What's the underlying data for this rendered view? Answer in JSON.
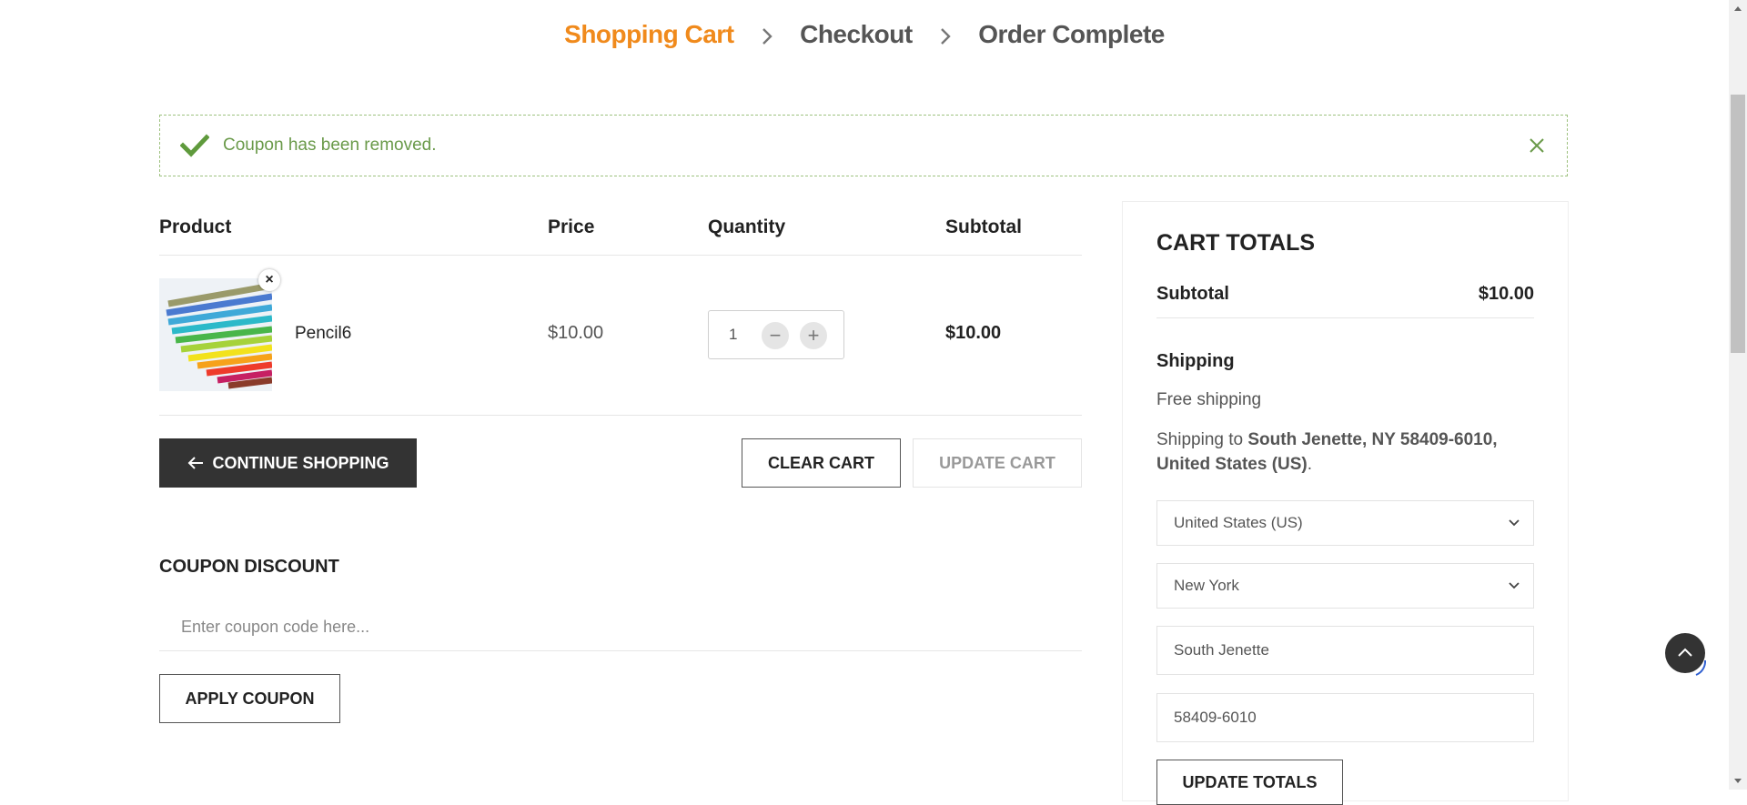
{
  "steps": {
    "cart": "Shopping Cart",
    "checkout": "Checkout",
    "complete": "Order Complete"
  },
  "notice": {
    "message": "Coupon has been removed.",
    "color": "#6a9a4a"
  },
  "table": {
    "headers": {
      "product": "Product",
      "price": "Price",
      "quantity": "Quantity",
      "subtotal": "Subtotal"
    },
    "item": {
      "name": "Pencil6",
      "price": "$10.00",
      "quantity": "1",
      "subtotal": "$10.00",
      "remove_label": "×"
    }
  },
  "actions": {
    "continue": "CONTINUE SHOPPING",
    "clear": "CLEAR CART",
    "update": "UPDATE CART"
  },
  "coupon": {
    "title": "COUPON DISCOUNT",
    "placeholder": "Enter coupon code here...",
    "apply": "APPLY COUPON"
  },
  "totals": {
    "title": "CART TOTALS",
    "subtotal_label": "Subtotal",
    "subtotal_value": "$10.00",
    "shipping_label": "Shipping",
    "shipping_method": "Free shipping",
    "shipping_to_prefix": "Shipping to ",
    "shipping_to_address_line1": "South Jenette, NY 58409-6010,",
    "shipping_to_address_line2": "United States (US)",
    "shipping_to_suffix": ".",
    "country": "United States (US)",
    "state": "New York",
    "city": "South Jenette",
    "postcode": "58409-6010",
    "update_button": "UPDATE TOTALS"
  },
  "colors": {
    "accent": "#f08a1c",
    "dark": "#333333"
  },
  "icons": [
    "chevron-right-icon",
    "checkmark-icon",
    "close-icon",
    "arrow-left-icon",
    "minus-icon",
    "plus-icon",
    "chevron-down-icon",
    "arrow-up-icon"
  ]
}
